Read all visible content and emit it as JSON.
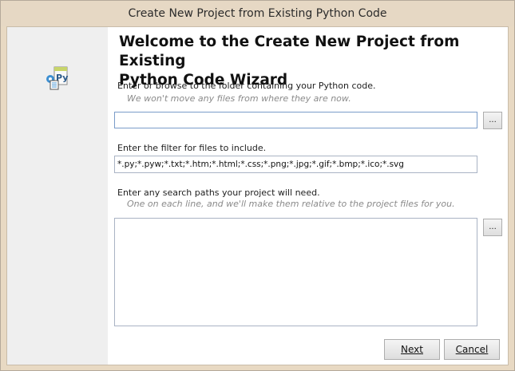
{
  "window": {
    "title": "Create New Project from Existing Python Code"
  },
  "wizard": {
    "heading_line1": "Welcome to the Create New Project from Existing",
    "heading_line2": "Python Code Wizard",
    "folder_label": "Enter or browse to the folder containing your Python code.",
    "folder_hint": "We won't move any files from where they are now.",
    "folder_value": "",
    "browse_label": "...",
    "filter_label": "Enter the filter for files to include.",
    "filter_value": "*.py;*.pyw;*.txt;*.htm;*.html;*.css;*.png;*.jpg;*.gif;*.bmp;*.ico;*.svg",
    "search_label": "Enter any search paths your project will need.",
    "search_hint": "One on each line, and we'll make them relative to the project files for you.",
    "search_value": "",
    "search_browse_label": "..."
  },
  "buttons": {
    "next": "Next",
    "cancel": "Cancel"
  },
  "icons": {
    "wizard_icon": "python-project-icon"
  }
}
